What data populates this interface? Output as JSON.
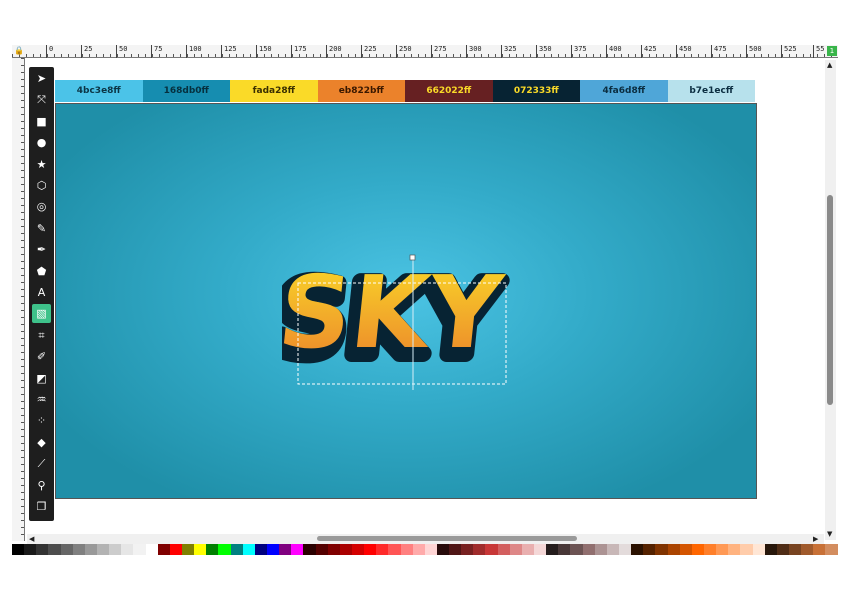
{
  "ruler": {
    "labels": [
      "0",
      "25",
      "50",
      "75",
      "100",
      "125",
      "150",
      "175",
      "200",
      "225",
      "250",
      "275",
      "300",
      "325",
      "350",
      "375",
      "400",
      "425",
      "450",
      "475",
      "500",
      "525",
      "55"
    ],
    "corner_badge": "1"
  },
  "swatches": [
    {
      "label": "4bc3e8ff",
      "bg": "#4bc3e8",
      "fg": "#0b3545"
    },
    {
      "label": "168db0ff",
      "bg": "#168db0",
      "fg": "#06303e"
    },
    {
      "label": "fada28ff",
      "bg": "#fada28",
      "fg": "#3a2f00"
    },
    {
      "label": "eb822bff",
      "bg": "#eb822b",
      "fg": "#3a1800"
    },
    {
      "label": "662022ff",
      "bg": "#662022",
      "fg": "#fada28"
    },
    {
      "label": "072333ff",
      "bg": "#072333",
      "fg": "#fada28"
    },
    {
      "label": "4fa6d8ff",
      "bg": "#4fa6d8",
      "fg": "#0b2d40"
    },
    {
      "label": "b7e1ecff",
      "bg": "#b7e1ec",
      "fg": "#0b2d40"
    }
  ],
  "artwork": {
    "text": "SKY",
    "fill_top": "#fada28",
    "fill_bottom": "#eb822b",
    "outline": "#072333"
  },
  "tools": [
    {
      "name": "selector-tool",
      "glyph": "➤"
    },
    {
      "name": "node-tool",
      "glyph": "⤧"
    },
    {
      "name": "rectangle-tool",
      "glyph": "■"
    },
    {
      "name": "ellipse-tool",
      "glyph": "●"
    },
    {
      "name": "star-tool",
      "glyph": "★"
    },
    {
      "name": "3d-box-tool",
      "glyph": "⬡"
    },
    {
      "name": "spiral-tool",
      "glyph": "◎"
    },
    {
      "name": "pencil-tool",
      "glyph": "✎"
    },
    {
      "name": "pen-tool",
      "glyph": "✒"
    },
    {
      "name": "calligraphy-tool",
      "glyph": "⬟"
    },
    {
      "name": "text-tool",
      "glyph": "A"
    },
    {
      "name": "gradient-tool",
      "glyph": "▧"
    },
    {
      "name": "mesh-tool",
      "glyph": "⌗"
    },
    {
      "name": "dropper-tool",
      "glyph": "✐"
    },
    {
      "name": "paint-bucket-tool",
      "glyph": "◩"
    },
    {
      "name": "tweak-tool",
      "glyph": "♒"
    },
    {
      "name": "spray-tool",
      "glyph": "⁘"
    },
    {
      "name": "eraser-tool",
      "glyph": "◆"
    },
    {
      "name": "connector-tool",
      "glyph": "⟋"
    },
    {
      "name": "zoom-tool",
      "glyph": "⚲"
    },
    {
      "name": "pages-tool",
      "glyph": "❐"
    }
  ],
  "active_tool": "gradient-tool",
  "palette": [
    "#000000",
    "#1a1a1a",
    "#333333",
    "#4d4d4d",
    "#666666",
    "#808080",
    "#999999",
    "#b3b3b3",
    "#cccccc",
    "#e6e6e6",
    "#f2f2f2",
    "#ffffff",
    "#800000",
    "#ff0000",
    "#808000",
    "#ffff00",
    "#008000",
    "#00ff00",
    "#008080",
    "#00ffff",
    "#000080",
    "#0000ff",
    "#800080",
    "#ff00ff",
    "#2b0000",
    "#550000",
    "#800000",
    "#aa0000",
    "#d40000",
    "#ff0000",
    "#ff2a2a",
    "#ff5555",
    "#ff8080",
    "#ffaaaa",
    "#ffd5d5",
    "#280b0b",
    "#501616",
    "#782121",
    "#a02c2c",
    "#c83737",
    "#d35f5f",
    "#de8787",
    "#e9afaf",
    "#f4d7d7",
    "#241c1c",
    "#483737",
    "#6c5353",
    "#916f6f",
    "#ac9393",
    "#c8b7b7",
    "#e3dbdb",
    "#2b1100",
    "#552200",
    "#803300",
    "#aa4400",
    "#d45500",
    "#ff6600",
    "#ff7f2a",
    "#ff9955",
    "#ffb380",
    "#ffccaa",
    "#ffe6d5",
    "#28170b",
    "#502d16",
    "#784421",
    "#a05a2c",
    "#c87137",
    "#d38d5f"
  ]
}
